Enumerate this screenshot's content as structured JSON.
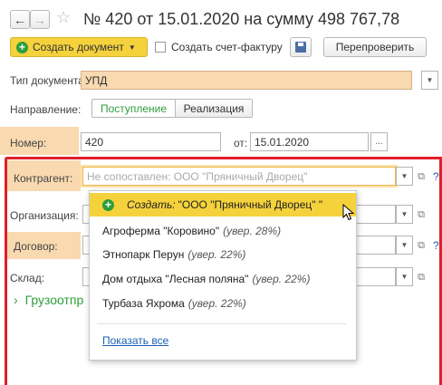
{
  "header": {
    "title": "№ 420 от 15.01.2020 на сумму 498 767,78",
    "back_icon": "arrow-left-icon",
    "forward_icon": "arrow-right-icon",
    "favorite_icon": "star-icon"
  },
  "toolbar": {
    "create_document_label": "Создать документ",
    "create_invoice_label": "Создать счет-фактуру",
    "recheck_label": "Перепроверить"
  },
  "form": {
    "doc_type_label": "Тип документа:",
    "doc_type_value": "УПД",
    "direction_label": "Направление:",
    "direction_incoming": "Поступление",
    "direction_outgoing": "Реализация",
    "number_label": "Номер:",
    "number_value": "420",
    "date_label": "от:",
    "date_value": "15.01.2020",
    "counterparty_label": "Контрагент:",
    "counterparty_placeholder": "Не сопоставлен: ООО \"Пряничный Дворец\"",
    "organization_label": "Организация:",
    "contract_label": "Договор:",
    "warehouse_label": "Склад:",
    "cargo_group_label": "Грузоотпр",
    "help_mark": "?"
  },
  "popup": {
    "create_prefix": "Создать:",
    "create_value": " \"ООО \"Пряничный Дворец\" \"",
    "items": [
      {
        "name": "Агроферма \"Коровино\"",
        "hint": "(увер. 28%)"
      },
      {
        "name": "Этнопарк Перун",
        "hint": "(увер. 22%)"
      },
      {
        "name": "Дом отдыха \"Лесная поляна\"",
        "hint": "(увер. 22%)"
      },
      {
        "name": "Турбаза Яхрома",
        "hint": "(увер. 22%)"
      }
    ],
    "show_all_label": "Показать все"
  },
  "colors": {
    "accent_yellow": "#f5d23c",
    "highlight_orange": "#f9d9b0",
    "frame_red": "#e0202a",
    "link_blue": "#1a5fb4",
    "green": "#2e9e3c"
  }
}
